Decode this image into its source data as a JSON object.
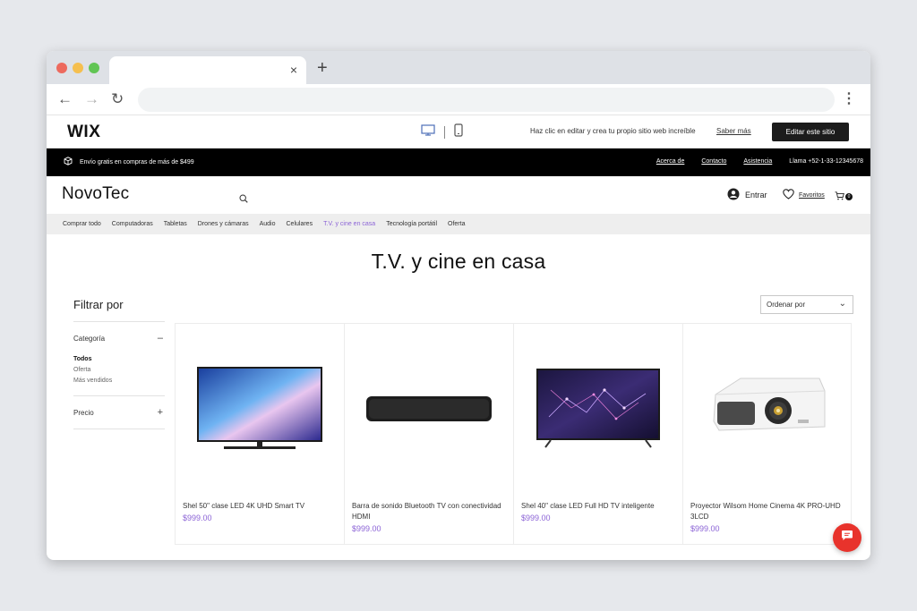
{
  "browser": {
    "tab_close": "×",
    "new_tab": "+",
    "back": "←",
    "forward": "→",
    "reload": "↻",
    "menu": "⋮",
    "url": ""
  },
  "wix_bar": {
    "logo": "WIX",
    "message": "Haz clic en editar y crea tu propio sitio web increíble",
    "learn_more": "Saber más",
    "edit_button": "Editar este sitio"
  },
  "promo_bar": {
    "shipping": "Envío gratis en compras de más de $499",
    "links": [
      "Acerca de",
      "Contacto",
      "Asistencia"
    ],
    "phone": "Llama +52-1-33-12345678"
  },
  "store_header": {
    "brand": "NovoTec",
    "login": "Entrar",
    "favorites": "Favoritos",
    "cart_count": "0"
  },
  "categories": {
    "items": [
      "Comprar todo",
      "Computadoras",
      "Tabletas",
      "Drones y cámaras",
      "Audio",
      "Celulares",
      "T.V. y cine en casa",
      "Tecnología portátil",
      "Oferta"
    ],
    "active_index": 6
  },
  "page": {
    "title": "T.V. y cine en casa",
    "filter_title": "Filtrar por",
    "sort_label": "Ordenar por",
    "sort_chevron": "⌄"
  },
  "filters": {
    "category_label": "Categoría",
    "category_sign": "–",
    "options": [
      "Todos",
      "Oferta",
      "Más vendidos"
    ],
    "price_label": "Precio",
    "price_sign": "+"
  },
  "products": [
    {
      "name": "Shel 50\" clase LED 4K UHD Smart TV",
      "price": "$999.00",
      "icon": "tv-icon"
    },
    {
      "name": "Barra de sonido Bluetooth TV con conectividad HDMI",
      "price": "$999.00",
      "icon": "soundbar-icon"
    },
    {
      "name": "Shel 40\" clase LED Full HD TV inteligente",
      "price": "$999.00",
      "icon": "tv-icon"
    },
    {
      "name": "Proyector Wilsom Home Cinema 4K PRO-UHD 3LCD",
      "price": "$999.00",
      "icon": "projector-icon"
    }
  ],
  "colors": {
    "accent": "#8b63d6",
    "chat": "#e8332c"
  }
}
